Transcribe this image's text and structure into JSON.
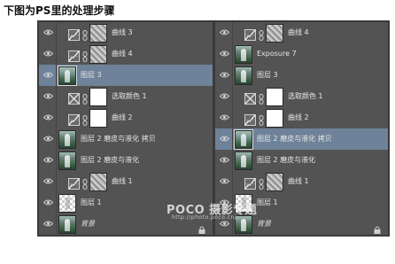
{
  "heading": "下图为PS里的处理步骤",
  "watermark": {
    "brand": "POCO 摄影专题",
    "url": "http://photo.poco.cn/"
  },
  "colors": {
    "panel_bg": "#535353",
    "selected_row": "#6e8399",
    "text": "#e6e6e6"
  },
  "left_panel": {
    "layers": [
      {
        "name": "曲线 3",
        "kind": "curves",
        "thumb": "curvemask",
        "selected": false
      },
      {
        "name": "曲线 4",
        "kind": "curves",
        "thumb": "curvemask",
        "selected": false
      },
      {
        "name": "图层 3",
        "kind": "pixel",
        "thumb": "photo",
        "selected": true
      },
      {
        "name": "选取颜色 1",
        "kind": "selective-color",
        "thumb": "mask-white",
        "selected": false
      },
      {
        "name": "曲线 2",
        "kind": "curves",
        "thumb": "mask-white",
        "selected": false
      },
      {
        "name": "图层 2 磨皮与液化 拷贝",
        "kind": "pixel",
        "thumb": "photo",
        "selected": false
      },
      {
        "name": "图层 2 磨皮与液化",
        "kind": "pixel",
        "thumb": "photo",
        "selected": false
      },
      {
        "name": "曲线 1",
        "kind": "curves",
        "thumb": "curvemask",
        "selected": false
      },
      {
        "name": "图层 1",
        "kind": "pixel",
        "thumb": "transparent",
        "selected": false
      },
      {
        "name": "背景",
        "kind": "background",
        "thumb": "photo",
        "selected": false,
        "italic": true,
        "locked": true
      }
    ]
  },
  "right_panel": {
    "layers": [
      {
        "name": "曲线 4",
        "kind": "curves",
        "thumb": "curvemask",
        "selected": false
      },
      {
        "name": "Exposure 7",
        "kind": "pixel",
        "thumb": "photo",
        "selected": false
      },
      {
        "name": "图层 3",
        "kind": "pixel",
        "thumb": "photo",
        "selected": false
      },
      {
        "name": "选取颜色 1",
        "kind": "selective-color",
        "thumb": "mask-white",
        "selected": false
      },
      {
        "name": "曲线 2",
        "kind": "curves",
        "thumb": "mask-white",
        "selected": false
      },
      {
        "name": "图层 2 磨皮与液化 拷贝",
        "kind": "pixel",
        "thumb": "photo",
        "selected": true
      },
      {
        "name": "图层 2 磨皮与液化",
        "kind": "pixel",
        "thumb": "photo",
        "selected": false
      },
      {
        "name": "曲线 1",
        "kind": "curves",
        "thumb": "curvemask",
        "selected": false
      },
      {
        "name": "图层 1",
        "kind": "pixel",
        "thumb": "transparent",
        "selected": false
      },
      {
        "name": "背景",
        "kind": "background",
        "thumb": "photo",
        "selected": false,
        "italic": true,
        "locked": true
      }
    ]
  },
  "icons": {
    "visibility": "eye-icon",
    "curves_adjustment": "curves-adjustment-icon",
    "selective_color_adjustment": "selective-color-icon",
    "mask_link": "chain-link-icon",
    "lock": "lock-icon"
  }
}
